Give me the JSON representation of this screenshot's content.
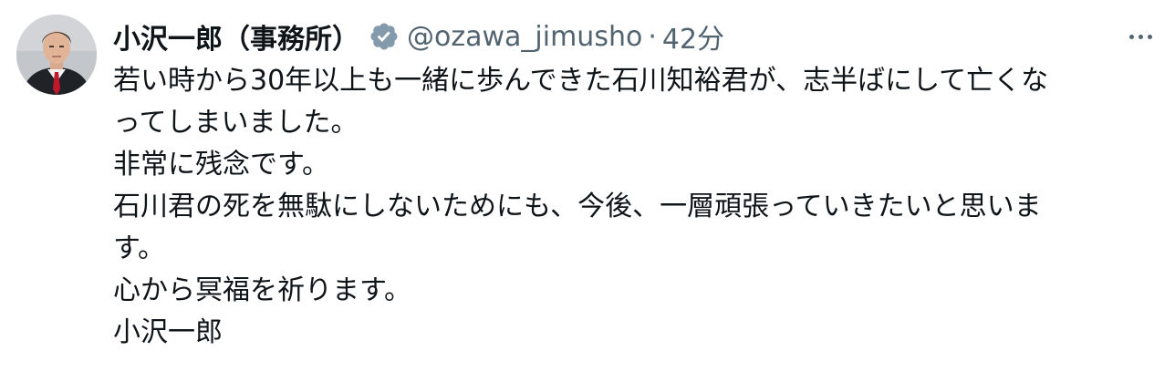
{
  "tweet": {
    "author": {
      "display_name": "小沢一郎（事務所）",
      "handle": "@ozawa_jimusho",
      "verified_color": "#829aab"
    },
    "separator": "·",
    "timestamp": "42分",
    "lines": [
      "若い時から30年以上も一緒に歩んできた石川知裕君が、志半ばにして亡くな",
      "ってしまいました。",
      "非常に残念です。",
      "石川君の死を無駄にしないためにも、今後、一層頑張っていきたいと思いま",
      "す。",
      "心から冥福を祈ります。",
      "小沢一郎"
    ],
    "icons": {
      "verified": "verified-badge-icon",
      "more": "more-options-icon"
    }
  }
}
